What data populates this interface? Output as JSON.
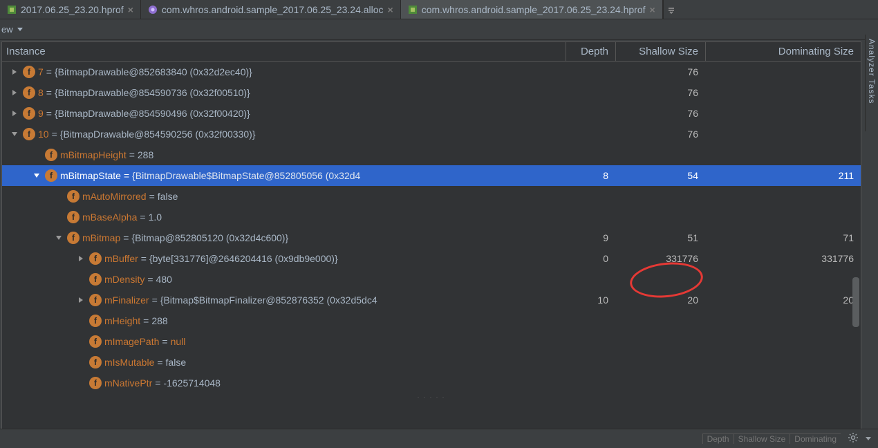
{
  "tabs": [
    {
      "label": "2017.06.25_23.20.hprof",
      "active": false
    },
    {
      "label": "com.whros.android.sample_2017.06.25_23.24.alloc",
      "active": false
    },
    {
      "label": "com.whros.android.sample_2017.06.25_23.24.hprof",
      "active": true
    }
  ],
  "toolbar": {
    "view_label": "ew"
  },
  "columns": {
    "name": "Instance",
    "depth": "Depth",
    "shallow": "Shallow Size",
    "dominating": "Dominating Size"
  },
  "rows": [
    {
      "indent": 0,
      "arrow": "right",
      "field": "7",
      "sep": " = ",
      "val": "{BitmapDrawable@852683840 (0x32d2ec40)}",
      "depth": "",
      "sh": "76",
      "dom": ""
    },
    {
      "indent": 0,
      "arrow": "right",
      "field": "8",
      "sep": " = ",
      "val": "{BitmapDrawable@854590736 (0x32f00510)}",
      "depth": "",
      "sh": "76",
      "dom": ""
    },
    {
      "indent": 0,
      "arrow": "right",
      "field": "9",
      "sep": " = ",
      "val": "{BitmapDrawable@854590496 (0x32f00420)}",
      "depth": "",
      "sh": "76",
      "dom": ""
    },
    {
      "indent": 0,
      "arrow": "down",
      "field": "10",
      "sep": " = ",
      "val": "{BitmapDrawable@854590256 (0x32f00330)}",
      "depth": "",
      "sh": "76",
      "dom": ""
    },
    {
      "indent": 1,
      "arrow": "",
      "field": "mBitmapHeight",
      "sep": " = ",
      "val": "288",
      "prim": true,
      "depth": "",
      "sh": "",
      "dom": ""
    },
    {
      "indent": 1,
      "arrow": "down",
      "field": "mBitmapState",
      "sep": " = ",
      "val": "{BitmapDrawable$BitmapState@852805056 (0x32d4",
      "depth": "8",
      "sh": "54",
      "dom": "211",
      "selected": true
    },
    {
      "indent": 2,
      "arrow": "",
      "field": "mAutoMirrored",
      "sep": " = ",
      "val": "false",
      "prim": true
    },
    {
      "indent": 2,
      "arrow": "",
      "field": "mBaseAlpha",
      "sep": " = ",
      "val": "1.0",
      "prim": true
    },
    {
      "indent": 2,
      "arrow": "down",
      "field": "mBitmap",
      "sep": " = ",
      "val": "{Bitmap@852805120 (0x32d4c600)}",
      "depth": "9",
      "sh": "51",
      "dom": "71"
    },
    {
      "indent": 3,
      "arrow": "right",
      "field": "mBuffer",
      "sep": " = ",
      "val": "{byte[331776]@2646204416 (0x9db9e000)}",
      "depth": "0",
      "sh": "331776",
      "dom": "331776"
    },
    {
      "indent": 3,
      "arrow": "",
      "field": "mDensity",
      "sep": " = ",
      "val": "480",
      "prim": true
    },
    {
      "indent": 3,
      "arrow": "right",
      "field": "mFinalizer",
      "sep": " = ",
      "val": "{Bitmap$BitmapFinalizer@852876352 (0x32d5dc4",
      "depth": "10",
      "sh": "20",
      "dom": "20"
    },
    {
      "indent": 3,
      "arrow": "",
      "field": "mHeight",
      "sep": " = ",
      "val": "288",
      "prim": true
    },
    {
      "indent": 3,
      "arrow": "",
      "field": "mImagePath",
      "sep": " = ",
      "val": "null",
      "isnull": true
    },
    {
      "indent": 3,
      "arrow": "",
      "field": "mIsMutable",
      "sep": " = ",
      "val": "false",
      "prim": true
    },
    {
      "indent": 3,
      "arrow": "",
      "field": "mNativePtr",
      "sep": " = ",
      "val": "-1625714048",
      "prim": true
    }
  ],
  "side_tab": "Analyzer Tasks",
  "footer_cols": [
    "Depth",
    "Shallow Size",
    "Dominating"
  ]
}
